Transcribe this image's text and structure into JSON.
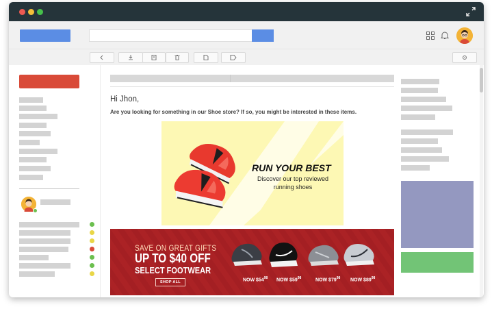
{
  "email": {
    "greeting": "Hi Jhon,",
    "body": "Are you looking for something in our Shoe store? If so, you might be interested in these items."
  },
  "hero": {
    "title": "RUN YOUR BEST",
    "subtitle": "Discover our top reviewed running shoes"
  },
  "promo": {
    "line1": "SAVE ON GREAT GIFTS",
    "line2": "UP TO $40 OFF",
    "line3": "SELECT FOOTWEAR",
    "button": "SHOP ALL",
    "prices": [
      {
        "prefix": "NOW $",
        "whole": "54",
        "cents": "98"
      },
      {
        "prefix": "NOW $",
        "whole": "59",
        "cents": "98"
      },
      {
        "prefix": "NOW $",
        "whole": "79",
        "cents": "98"
      },
      {
        "prefix": "NOW $",
        "whole": "89",
        "cents": "98"
      }
    ]
  },
  "colors": {
    "titlebar": "#25343a",
    "accent_blue": "#5b8de4",
    "compose_red": "#d94a38",
    "promo_red": "#a41f23",
    "hero_yellow": "#fdf8b4",
    "ad_purple": "#9498c0",
    "ad_green": "#72c476",
    "status": [
      "#6bbf4e",
      "#e9d646",
      "#d94a38"
    ]
  },
  "icons": [
    "fullscreen-icon",
    "apps-grid-icon",
    "bell-icon",
    "avatar-icon",
    "back-arrow-icon",
    "download-icon",
    "archive-icon",
    "delete-icon",
    "document-icon",
    "tag-icon",
    "settings-icon"
  ]
}
